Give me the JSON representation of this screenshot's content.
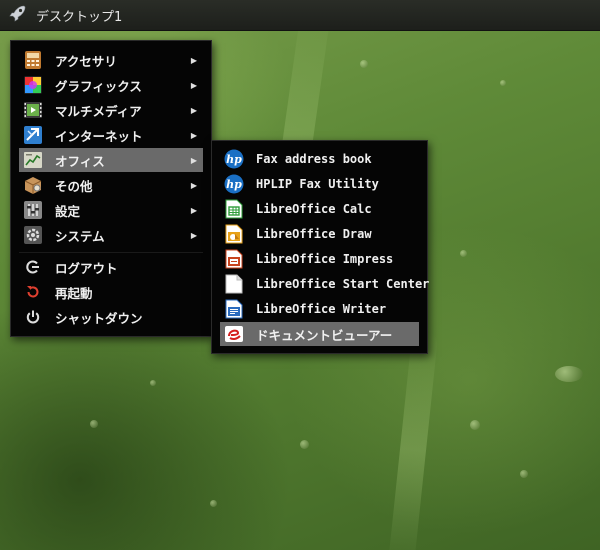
{
  "panel": {
    "title": "デスクトップ1",
    "launcher_icon": "rocket-icon"
  },
  "main_menu": {
    "categories": [
      {
        "label": "アクセサリ",
        "icon": "accessories-icon",
        "has_submenu": true
      },
      {
        "label": "グラフィックス",
        "icon": "graphics-icon",
        "has_submenu": true
      },
      {
        "label": "マルチメディア",
        "icon": "multimedia-icon",
        "has_submenu": true
      },
      {
        "label": "インターネット",
        "icon": "internet-icon",
        "has_submenu": true
      },
      {
        "label": "オフィス",
        "icon": "office-icon",
        "has_submenu": true,
        "active": true
      },
      {
        "label": "その他",
        "icon": "other-icon",
        "has_submenu": true
      },
      {
        "label": "設定",
        "icon": "settings-icon",
        "has_submenu": true
      },
      {
        "label": "システム",
        "icon": "system-icon",
        "has_submenu": true
      }
    ],
    "actions": [
      {
        "label": "ログアウト",
        "icon": "logout-icon"
      },
      {
        "label": "再起動",
        "icon": "restart-icon"
      },
      {
        "label": "シャットダウン",
        "icon": "shutdown-icon"
      }
    ],
    "submenu_arrow": "▶"
  },
  "office_submenu": {
    "items": [
      {
        "label": "Fax address book",
        "icon": "hp-icon"
      },
      {
        "label": "HPLIP Fax Utility",
        "icon": "hp-icon"
      },
      {
        "label": "LibreOffice Calc",
        "icon": "libreoffice-calc-icon"
      },
      {
        "label": "LibreOffice Draw",
        "icon": "libreoffice-draw-icon"
      },
      {
        "label": "LibreOffice Impress",
        "icon": "libreoffice-impress-icon"
      },
      {
        "label": "LibreOffice Start Center",
        "icon": "libreoffice-start-center-icon"
      },
      {
        "label": "LibreOffice Writer",
        "icon": "libreoffice-writer-icon"
      },
      {
        "label": "ドキュメントビューアー",
        "icon": "document-viewer-icon",
        "active": true
      }
    ]
  },
  "colors": {
    "menu_background": "#050505",
    "active_item": "#6a6a6a",
    "text": "#f0f0f0",
    "panel": "#1d1f1b",
    "hp_blue": "#1a6fc4",
    "calc_green": "#2f9e3a",
    "draw_orange": "#e8a21a",
    "impress_red": "#c8431e",
    "writer_blue": "#2a6bbf",
    "restart_red": "#e04030"
  }
}
